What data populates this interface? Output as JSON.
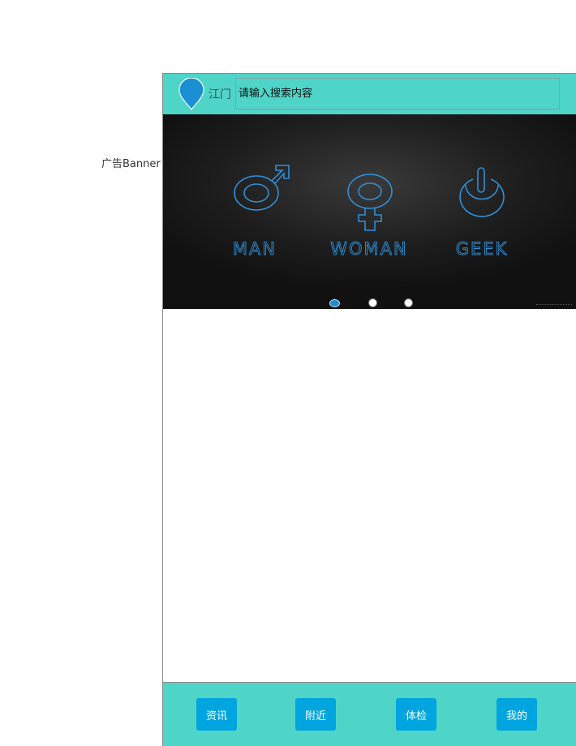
{
  "annotation": {
    "banner_label": "广告Banner"
  },
  "header": {
    "city": "江门",
    "search_placeholder": "请输入搜索内容"
  },
  "banner": {
    "items": [
      {
        "label": "MAN",
        "icon": "male-symbol-icon"
      },
      {
        "label": "WOMAN",
        "icon": "female-symbol-icon"
      },
      {
        "label": "GEEK",
        "icon": "power-icon"
      }
    ],
    "slide_count": 3,
    "active_slide": 1
  },
  "bottom_nav": {
    "items": [
      {
        "label": "资讯"
      },
      {
        "label": "附近"
      },
      {
        "label": "体检"
      },
      {
        "label": "我的"
      }
    ]
  },
  "colors": {
    "header_bg": "#4fd4c8",
    "nav_button": "#00a5e0",
    "pin": "#1a8fd4",
    "banner_glyph": "#2f8fd8"
  }
}
